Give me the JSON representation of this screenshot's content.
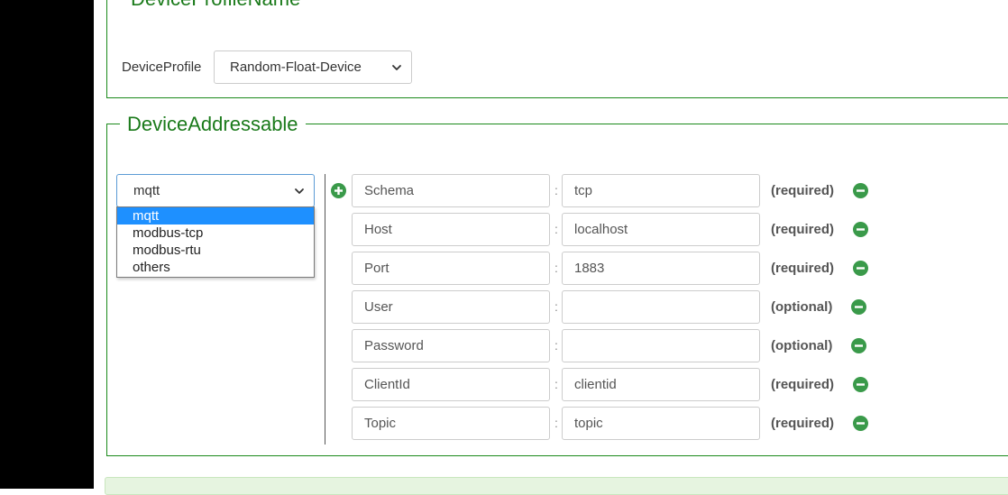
{
  "profile_section": {
    "legend": "DeviceProfileName",
    "label": "DeviceProfile",
    "selected": "Random-Float-Device"
  },
  "addressable_section": {
    "legend": "DeviceAddressable",
    "protocol_select": {
      "selected": "mqtt",
      "options": [
        "mqtt",
        "modbus-tcp",
        "modbus-rtu",
        "others"
      ],
      "highlighted": "mqtt"
    },
    "separator": ":",
    "rows": [
      {
        "key": "Schema",
        "value": "tcp",
        "requirement": "(required)"
      },
      {
        "key": "Host",
        "value": "localhost",
        "requirement": "(required)"
      },
      {
        "key": "Port",
        "value": "1883",
        "requirement": "(required)"
      },
      {
        "key": "User",
        "value": "",
        "requirement": "(optional)"
      },
      {
        "key": "Password",
        "value": "",
        "requirement": "(optional)"
      },
      {
        "key": "ClientId",
        "value": "clientid",
        "requirement": "(required)"
      },
      {
        "key": "Topic",
        "value": "topic",
        "requirement": "(required)"
      }
    ]
  },
  "colors": {
    "accent_green": "#1a7a1a",
    "icon_green": "#3a9a4a",
    "selection_blue": "#1e90ff"
  },
  "icons": {
    "add": "plus-circle-icon",
    "remove": "minus-circle-icon",
    "dropdown": "chevron-down-icon"
  }
}
